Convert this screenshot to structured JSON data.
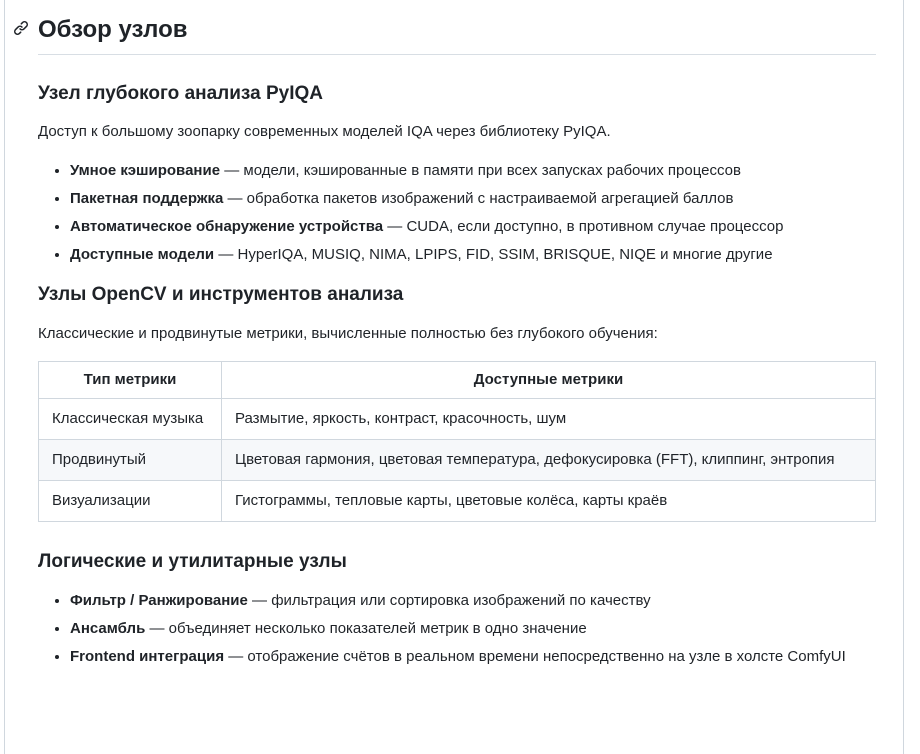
{
  "title": "Обзор узлов",
  "sections": [
    {
      "heading": "Узел глубокого анализа PyIQA",
      "intro": "Доступ к большому зоопарку современных моделей IQA через библиотеку PyIQA.",
      "items": [
        {
          "bold": "Умное кэширование",
          "text": " — модели, кэшированные в памяти при всех запусках рабочих процессов"
        },
        {
          "bold": "Пакетная поддержка",
          "text": " — обработка пакетов изображений с настраиваемой агрегацией баллов"
        },
        {
          "bold": "Автоматическое обнаружение устройства",
          "text": " — CUDA, если доступно, в противном случае процессор"
        },
        {
          "bold": "Доступные модели",
          "text": " — HyperIQA, MUSIQ, NIMA, LPIPS, FID, SSIM, BRISQUE, NIQE и многие другие"
        }
      ]
    },
    {
      "heading": "Узлы OpenCV и инструментов анализа",
      "intro": "Классические и продвинутые метрики, вычисленные полностью без глубокого обучения:",
      "table": {
        "headers": [
          "Тип метрики",
          "Доступные метрики"
        ],
        "rows": [
          [
            "Классическая музыка",
            "Размытие, яркость, контраст, красочность, шум"
          ],
          [
            "Продвинутый",
            "Цветовая гармония, цветовая температура, дефокусировка (FFT), клиппинг, энтропия"
          ],
          [
            "Визуализации",
            "Гистограммы, тепловые карты, цветовые колёса, карты краёв"
          ]
        ]
      }
    },
    {
      "heading": "Логические и утилитарные узлы",
      "items": [
        {
          "bold": "Фильтр / Ранжирование",
          "text": " — фильтрация или сортировка изображений по качеству"
        },
        {
          "bold": "Ансамбль",
          "text": " — объединяет несколько показателей метрик в одно значение"
        },
        {
          "bold": "Frontend интеграция",
          "text": " — отображение счётов в реальном времени непосредственно на узле в холсте ComfyUI"
        }
      ]
    }
  ],
  "icons": {
    "heading_anchor": "link-icon"
  }
}
